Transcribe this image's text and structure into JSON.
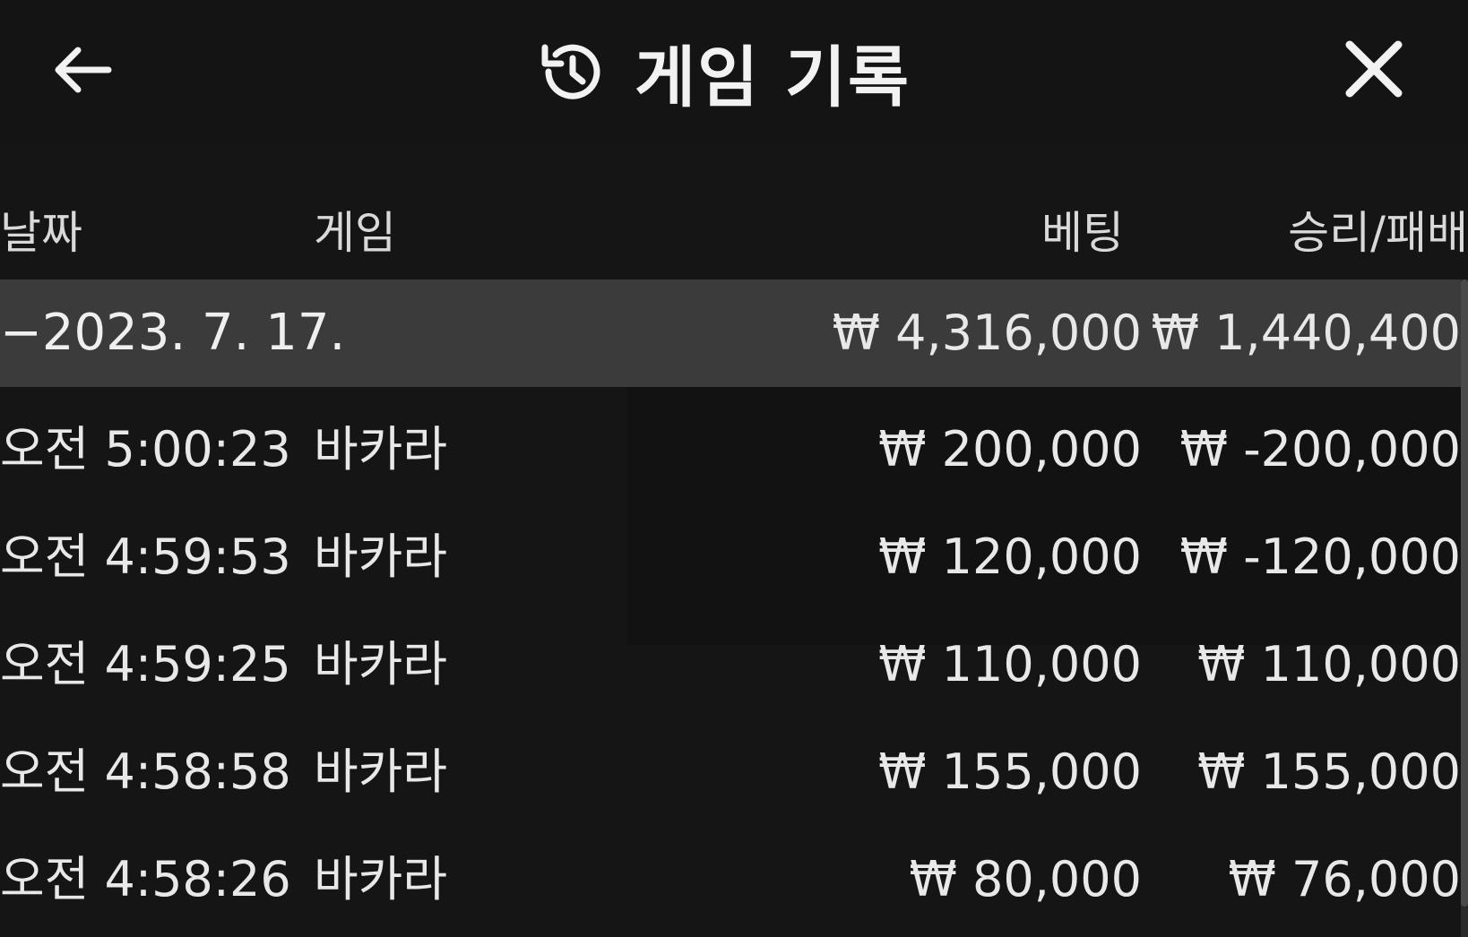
{
  "header": {
    "title": "게임 기록",
    "back_icon": "arrow-left-icon",
    "history_icon": "history-clock-icon",
    "close_icon": "close-icon"
  },
  "columns": {
    "date": "날짜",
    "game": "게임",
    "bet": "베팅",
    "result": "승리/패배"
  },
  "summary": {
    "date": "−2023. 7. 17.",
    "bet": "₩ 4,316,000",
    "result": "₩ 1,440,400"
  },
  "rows": [
    {
      "time": "오전 5:00:23",
      "game": "바카라",
      "bet": "₩ 200,000",
      "result": "₩ -200,000"
    },
    {
      "time": "오전 4:59:53",
      "game": "바카라",
      "bet": "₩ 120,000",
      "result": "₩ -120,000"
    },
    {
      "time": "오전 4:59:25",
      "game": "바카라",
      "bet": "₩ 110,000",
      "result": "₩ 110,000"
    },
    {
      "time": "오전 4:58:58",
      "game": "바카라",
      "bet": "₩ 155,000",
      "result": "₩ 155,000"
    },
    {
      "time": "오전 4:58:26",
      "game": "바카라",
      "bet": "₩ 80,000",
      "result": "₩ 76,000"
    }
  ],
  "colors": {
    "background": "#151515",
    "summary_row": "#3b3b3b",
    "text": "#e8e8e8"
  }
}
